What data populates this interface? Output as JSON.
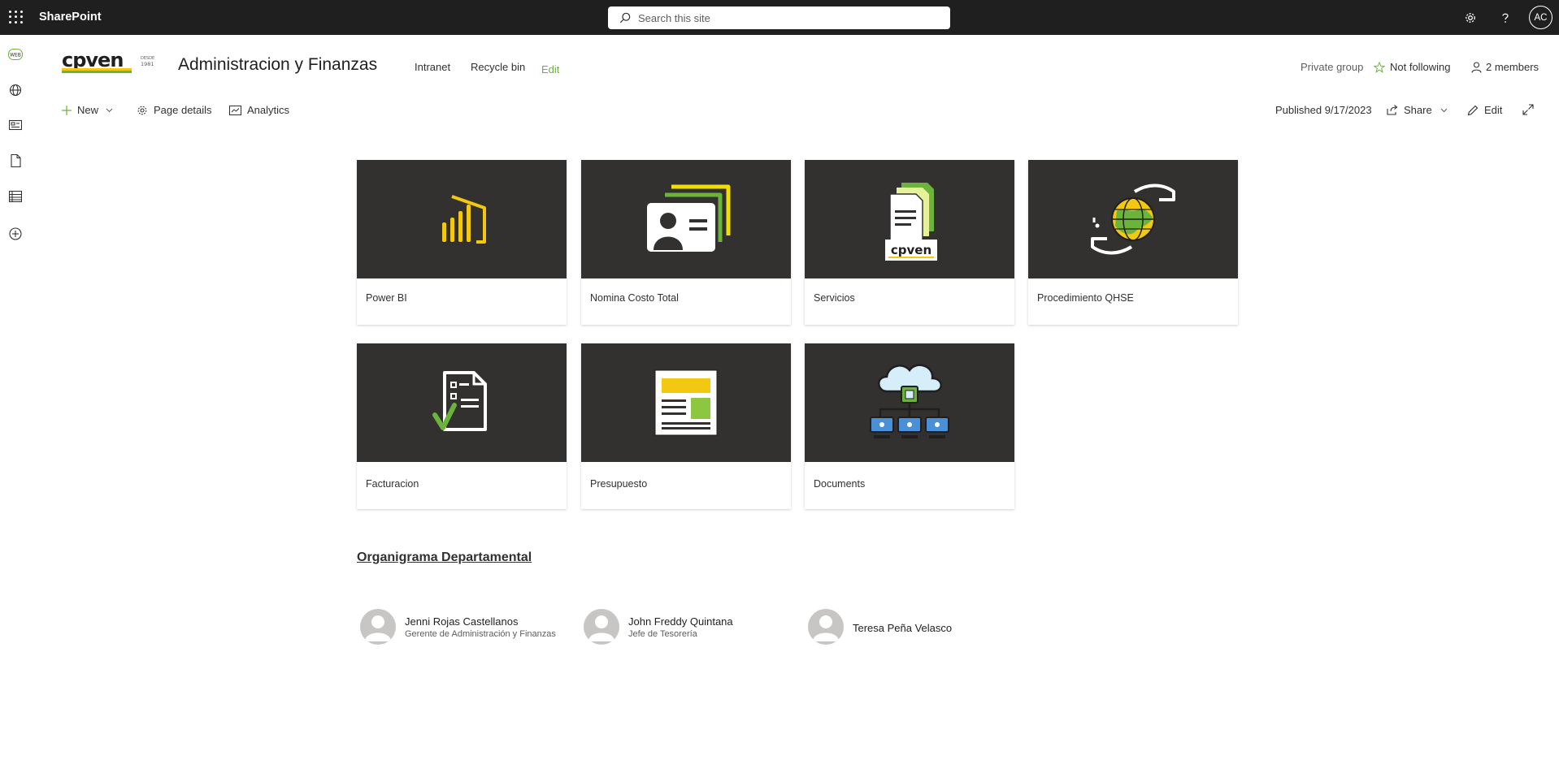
{
  "suite": {
    "app_name": "SharePoint",
    "search_placeholder": "Search this site",
    "user_initials": "AC"
  },
  "rail": {
    "items": [
      "home-icon",
      "globe-icon",
      "news-icon",
      "file-icon",
      "list-icon",
      "add-icon"
    ],
    "web_label": "WEB"
  },
  "site": {
    "logo_text": "cpven",
    "logo_sub_top": "DESDE",
    "logo_sub_bottom": "1981",
    "title": "Administracion y Finanzas",
    "nav": [
      "Intranet",
      "Recycle bin"
    ],
    "edit_link": "Edit",
    "privacy": "Private group",
    "follow": "Not following",
    "members": "2 members"
  },
  "commandbar": {
    "new": "New",
    "page_details": "Page details",
    "analytics": "Analytics",
    "published": "Published 9/17/2023",
    "share": "Share",
    "edit": "Edit"
  },
  "tiles": [
    {
      "label": "Power BI",
      "icon": "power-bi-icon"
    },
    {
      "label": "Nomina Costo Total",
      "icon": "id-card-icon"
    },
    {
      "label": "Servicios",
      "icon": "documents-stack-icon"
    },
    {
      "label": "Procedimiento QHSE",
      "icon": "globe-hands-icon"
    },
    {
      "label": "Facturacion",
      "icon": "invoice-check-icon"
    },
    {
      "label": "Presupuesto",
      "icon": "budget-sheet-icon"
    },
    {
      "label": "Documents",
      "icon": "cloud-network-icon"
    }
  ],
  "org": {
    "title": "Organigrama Departamental",
    "people": [
      {
        "name": "Jenni Rojas Castellanos",
        "role": "Gerente de Administración y Finanzas"
      },
      {
        "name": "John Freddy Quintana",
        "role": "Jefe de Tesorería"
      },
      {
        "name": "Teresa Peña Velasco",
        "role": ""
      }
    ]
  },
  "colors": {
    "suitebar": "#1f1f1f",
    "accent_green": "#6bb33a",
    "tile_bg": "#323130",
    "powerbi_yellow": "#f2c811"
  }
}
